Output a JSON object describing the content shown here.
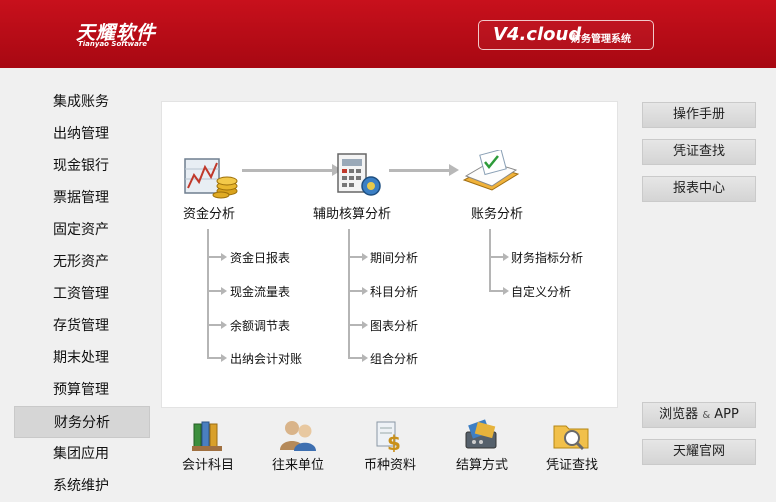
{
  "header": {
    "logo_cn": "天耀软件",
    "logo_en": "Tianyao Software",
    "version": "V4.cloud",
    "product": "财务管理系统"
  },
  "menu": {
    "items": [
      "集成账务",
      "出纳管理",
      "现金银行",
      "票据管理",
      "固定资产",
      "无形资产",
      "工资管理",
      "存货管理",
      "期末处理",
      "预算管理",
      "财务分析",
      "集团应用",
      "系统维护"
    ],
    "active": "财务分析"
  },
  "modules": [
    {
      "label": "资金分析",
      "icon": "fund-chart-coins-icon",
      "subs": [
        "资金日报表",
        "现金流量表",
        "余额调节表",
        "出纳会计对账"
      ]
    },
    {
      "label": "辅助核算分析",
      "icon": "calculator-document-icon",
      "subs": [
        "期间分析",
        "科目分析",
        "图表分析",
        "组合分析"
      ]
    },
    {
      "label": "账务分析",
      "icon": "ledger-book-icon",
      "subs": [
        "财务指标分析",
        "自定义分析"
      ]
    }
  ],
  "right_buttons_top": [
    "操作手册",
    "凭证查找",
    "报表中心"
  ],
  "right_buttons_bottom": {
    "browser_main": "浏览器",
    "browser_amp": "&",
    "browser_app": "APP",
    "official": "天耀官网"
  },
  "quick_links": [
    {
      "label": "会计科目",
      "icon": "binders-icon"
    },
    {
      "label": "往来单位",
      "icon": "users-icon"
    },
    {
      "label": "币种资料",
      "icon": "currency-icon"
    },
    {
      "label": "结算方式",
      "icon": "payment-icon"
    },
    {
      "label": "凭证查找",
      "icon": "folder-search-icon"
    }
  ]
}
